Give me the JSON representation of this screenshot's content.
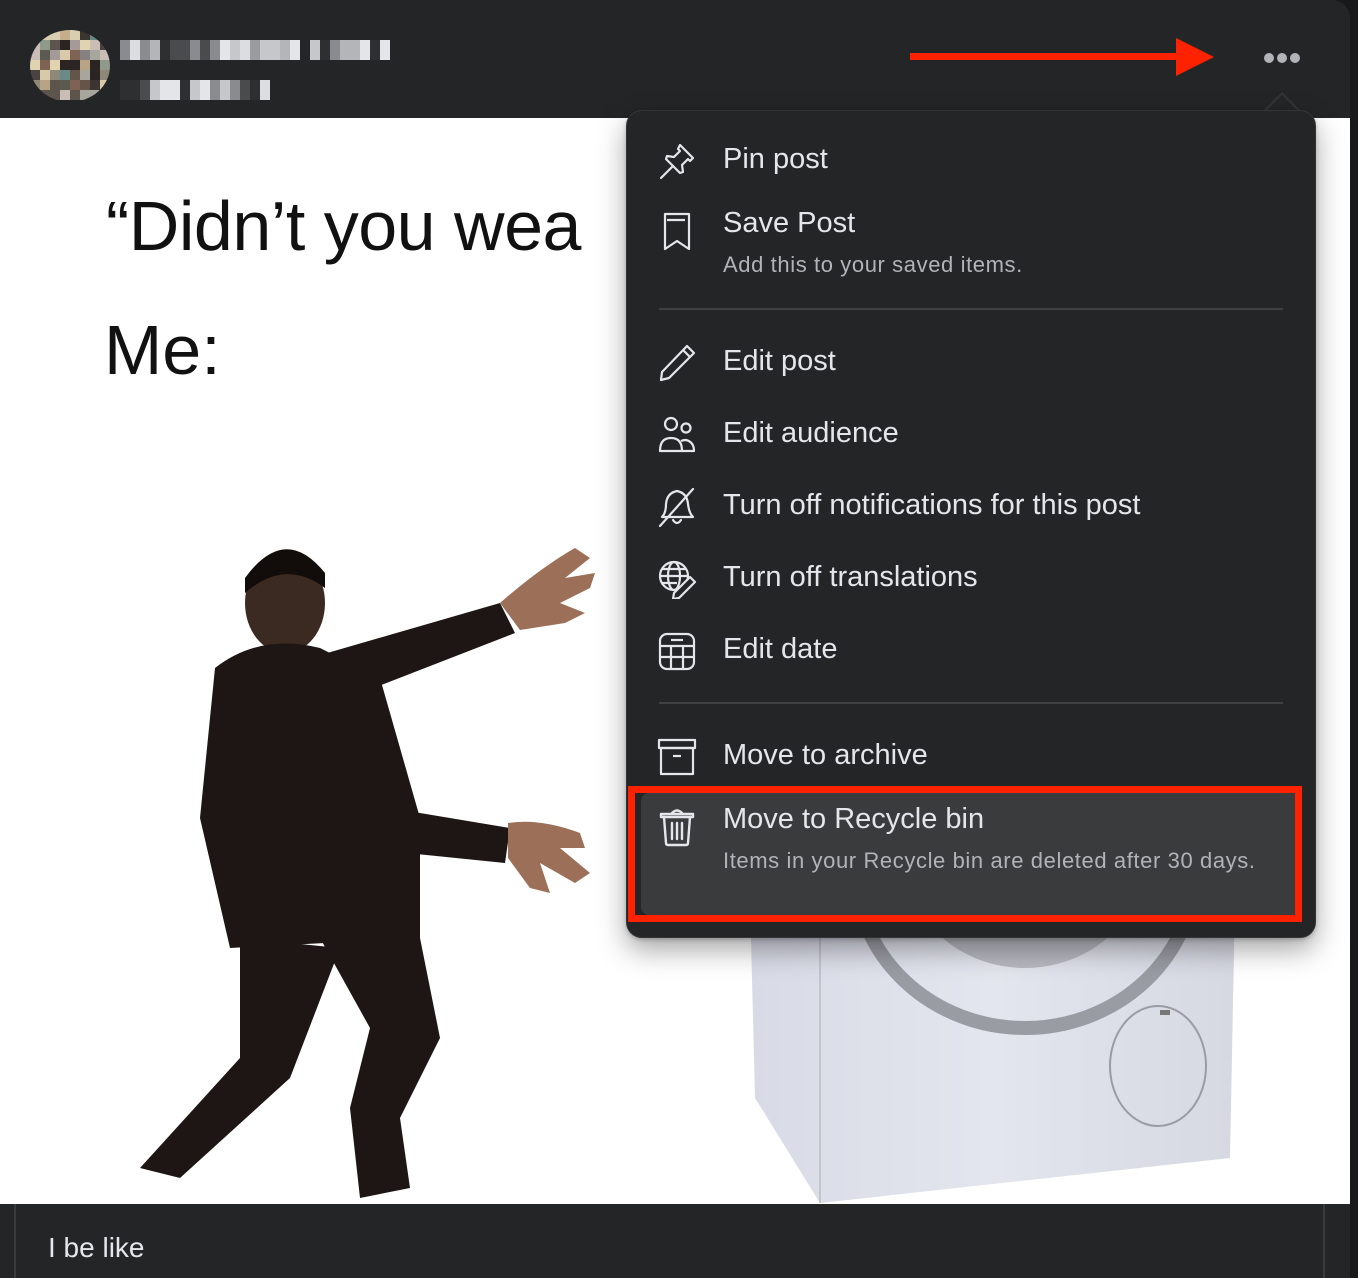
{
  "post": {
    "author_name": "[blurred]",
    "timestamp": "[blurred]",
    "more_button_label": "More options",
    "meme_text_line1": "“Didn’t you wea",
    "meme_text_line2": "Me:",
    "caption": "I be like"
  },
  "menu": {
    "items": [
      {
        "id": "pin",
        "label": "Pin post",
        "icon": "pushpin-icon"
      },
      {
        "id": "save",
        "label": "Save Post",
        "sublabel": "Add this to your saved items.",
        "icon": "bookmark-icon"
      },
      {
        "id": "edit-post",
        "label": "Edit post",
        "icon": "pencil-icon"
      },
      {
        "id": "edit-audience",
        "label": "Edit audience",
        "icon": "people-icon"
      },
      {
        "id": "notifications",
        "label": "Turn off notifications for this post",
        "icon": "bell-off-icon"
      },
      {
        "id": "translations",
        "label": "Turn off translations",
        "icon": "globe-pencil-icon"
      },
      {
        "id": "edit-date",
        "label": "Edit date",
        "icon": "calendar-icon"
      },
      {
        "id": "archive",
        "label": "Move to archive",
        "icon": "archive-box-icon"
      },
      {
        "id": "recycle",
        "label": "Move to Recycle bin",
        "sublabel": "Items in your Recycle bin are deleted after 30 days.",
        "icon": "trash-icon",
        "highlighted": true
      }
    ]
  },
  "annotations": {
    "arrow_color": "#ff2200",
    "highlight_box_color": "#ff2200"
  },
  "colors": {
    "surface": "#242526",
    "text_primary": "#e4e6eb",
    "text_secondary": "#b0b3b8",
    "hover": "#3a3b3c"
  }
}
